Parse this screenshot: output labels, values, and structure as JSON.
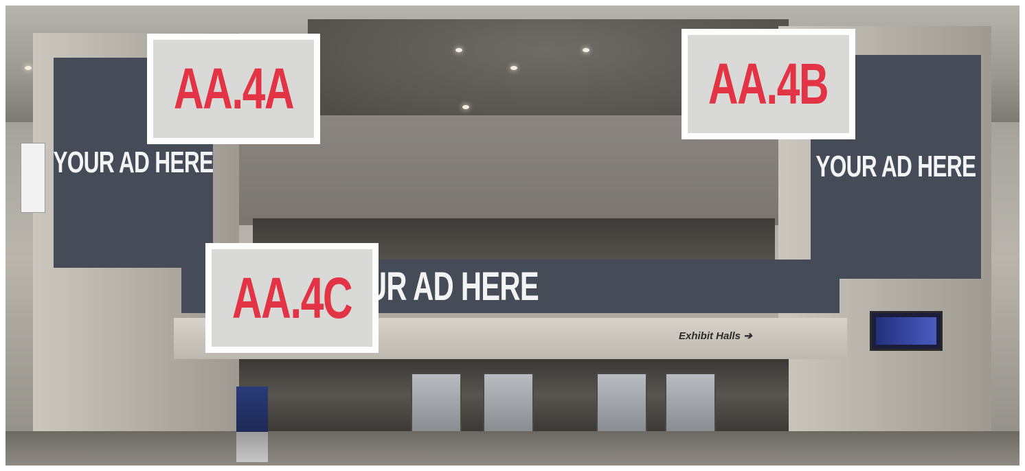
{
  "scene": {
    "description_icon": "convention-center-lobby",
    "ad_panels": [
      {
        "id": "left_vertical",
        "text": "YOUR AD HERE"
      },
      {
        "id": "right_vertical",
        "text": "YOUR AD HERE"
      },
      {
        "id": "center_horizontal",
        "text": "YOUR AD HERE"
      }
    ],
    "labels": [
      {
        "id": "a",
        "text": "AA.4A"
      },
      {
        "id": "b",
        "text": "AA.4B"
      },
      {
        "id": "c",
        "text": "AA.4C"
      }
    ],
    "signage": {
      "exhibit_halls": "Exhibit Halls ➔"
    }
  },
  "colors": {
    "ad_panel_bg": "#454c57",
    "label_text": "#e23444",
    "label_frame": "#ffffff"
  }
}
